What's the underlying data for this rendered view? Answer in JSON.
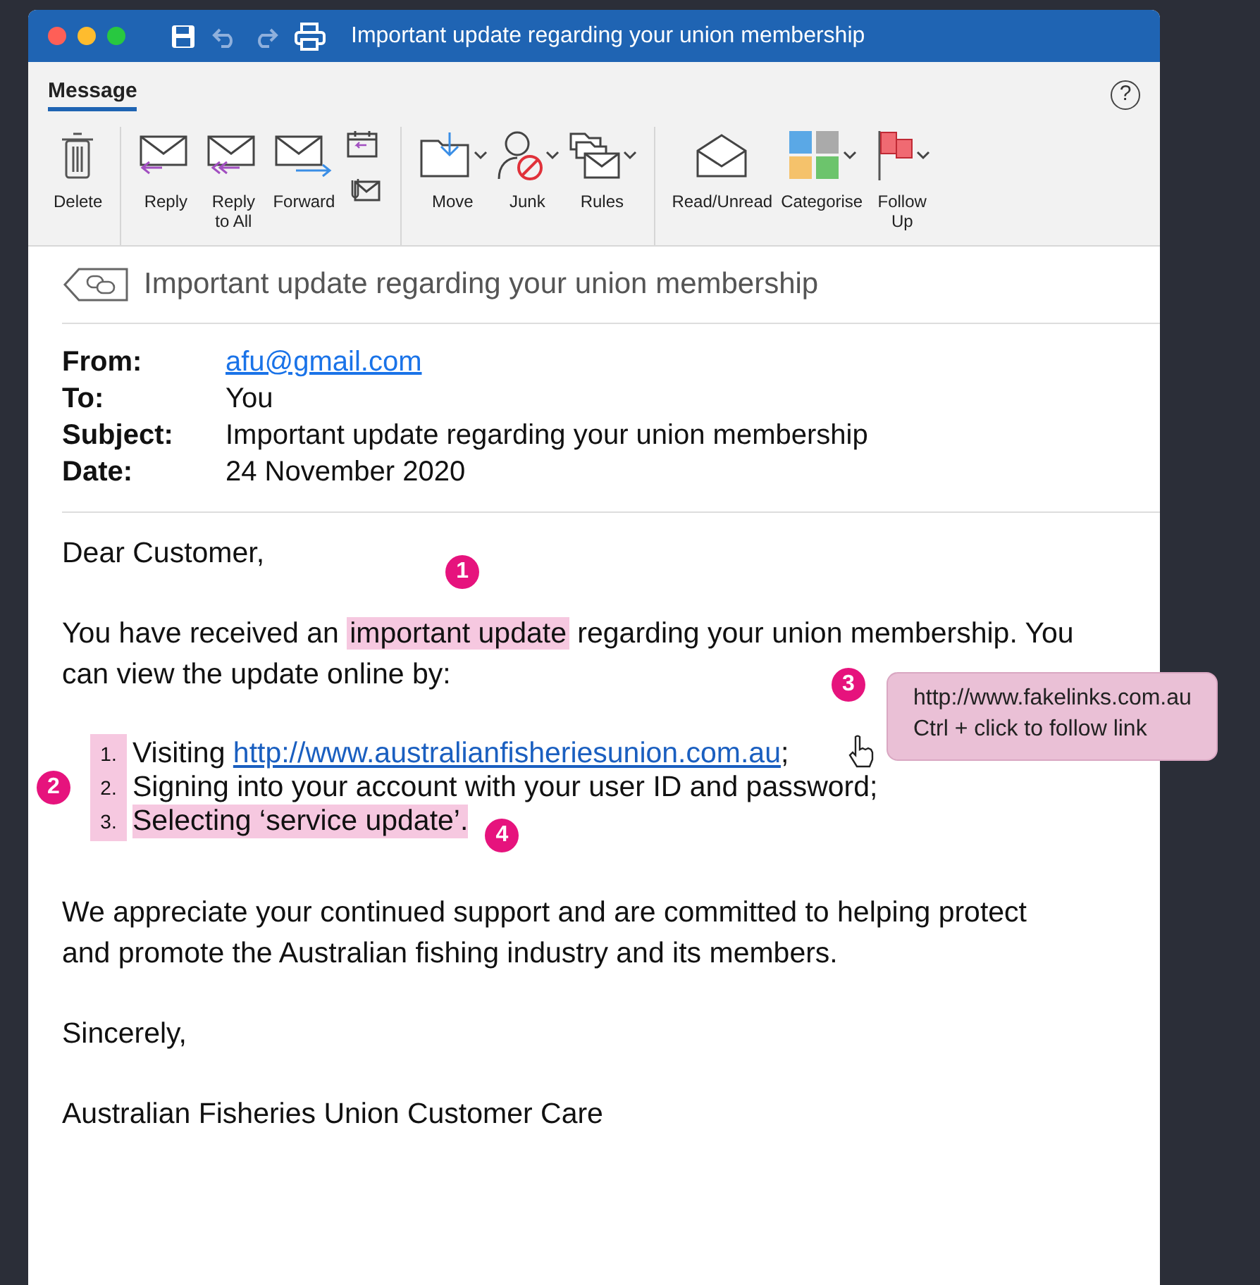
{
  "window": {
    "title": "Important update regarding your union membership"
  },
  "tabs": [
    {
      "label": "Message",
      "selected": true
    }
  ],
  "help_button": "?",
  "ribbon": {
    "groups": [
      {
        "buttons": [
          {
            "label": "Delete",
            "dropdown": false
          }
        ]
      },
      {
        "buttons": [
          {
            "label": "Reply",
            "dropdown": false
          },
          {
            "label": "Reply to All",
            "dropdown": false
          },
          {
            "label": "Forward",
            "dropdown": false
          }
        ]
      },
      {
        "buttons": [
          {
            "label": "Move",
            "dropdown": true
          },
          {
            "label": "Junk",
            "dropdown": true
          },
          {
            "label": "Rules",
            "dropdown": true
          }
        ]
      },
      {
        "buttons": [
          {
            "label": "Read/Unread",
            "dropdown": false
          },
          {
            "label": "Categorise",
            "dropdown": true
          },
          {
            "label": "Follow Up",
            "dropdown": true
          }
        ]
      }
    ]
  },
  "message": {
    "subject": "Important update regarding your union membership",
    "headers": [
      {
        "label": "From:",
        "value": "afu@gmail.com",
        "link": true
      },
      {
        "label": "To:",
        "value": "You",
        "link": false
      },
      {
        "label": "Subject:",
        "value": "Important update regarding your union membership",
        "link": false
      },
      {
        "label": "Date:",
        "value": "24 November 2020",
        "link": false
      }
    ],
    "greeting": "Dear Customer,",
    "intro": {
      "before": "You have received an ",
      "highlight": "important update",
      "after": " regarding your union membership. You can view the update online by:",
      "badge": "1"
    },
    "steps": {
      "badge": "2",
      "items": [
        {
          "number": "1.",
          "text": "Visiting ",
          "link": "http://www.australianfisheriesunion.com.au",
          "after": ";",
          "highlighted": false
        },
        {
          "number": "2.",
          "text": "Signing into your account with your user ID and password;",
          "highlighted": false
        },
        {
          "number": "3.",
          "text": "Selecting ‘service update’.",
          "highlighted": true,
          "badge": "4"
        }
      ]
    },
    "tooltip": {
      "badge": "3",
      "url": "http://www.fakelinks.com.au",
      "hint": "Ctrl + click to follow link"
    },
    "closing": "We appreciate your continued support and are committed to helping protect and promote the Australian fishing industry and its members.",
    "signoff": "Sincerely,",
    "signature": "Australian Fisheries Union Customer Care"
  }
}
